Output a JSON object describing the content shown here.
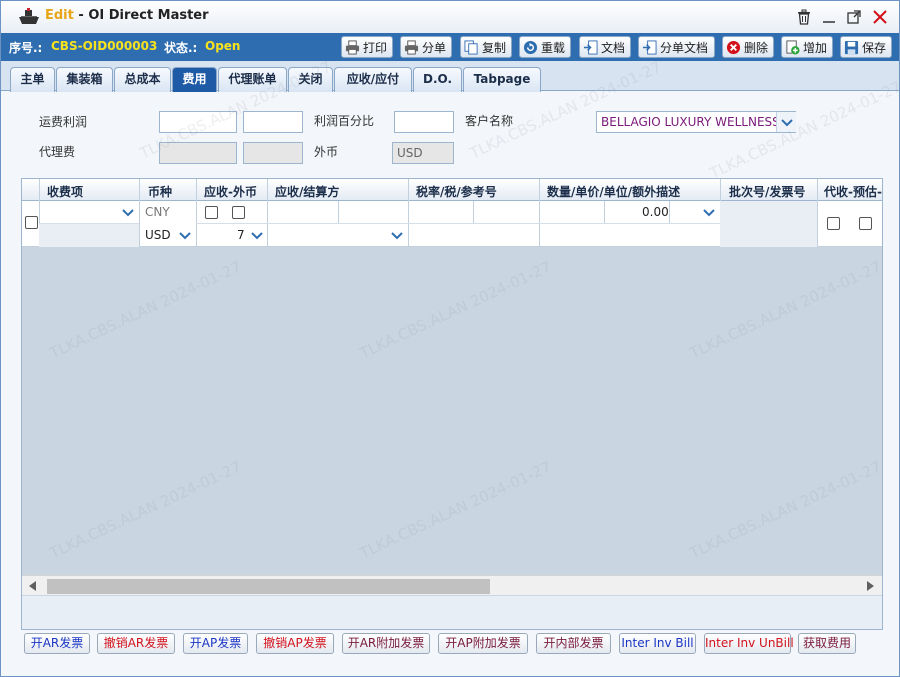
{
  "window": {
    "title_prefix": "Edit",
    "title_sep": " - ",
    "title": "OI Direct Master"
  },
  "info": {
    "serial_label": "序号.:",
    "serial_value": "CBS-OID000003",
    "status_label": "状态.:",
    "status_value": "Open"
  },
  "toolbar": {
    "print": "打印",
    "split": "分单",
    "copy": "复制",
    "reload": "重载",
    "docs": "文档",
    "split_docs": "分单文档",
    "delete": "删除",
    "add": "增加",
    "save": "保存"
  },
  "tabs": [
    {
      "label": "主单"
    },
    {
      "label": "集装箱"
    },
    {
      "label": "总成本"
    },
    {
      "label": "费用"
    },
    {
      "label": "代理账单"
    },
    {
      "label": "关闭"
    },
    {
      "label": "应收/应付"
    },
    {
      "label": "D.O."
    },
    {
      "label": "Tabpage"
    }
  ],
  "form": {
    "freight_profit_label": "运费利润",
    "agency_fee_label": "代理费",
    "profit_pct_label": "利润百分比",
    "foreign_currency_label": "外币",
    "foreign_currency_value": "USD",
    "customer_label": "客户名称",
    "customer_value": "BELLAGIO LUXURY WELLNESS"
  },
  "grid": {
    "headers": {
      "charge_item": "收费项",
      "currency": "币种",
      "ar_foreign": "应收-外币",
      "ar_settlement": "应收/结算方",
      "tax": "税率/税/参考号",
      "qty": "数量/单价/单位/额外描述",
      "batch": "批次号/发票号",
      "collect": "代收-预估-"
    },
    "row": {
      "currency1": "CNY",
      "currency2": "USD",
      "rate": "7",
      "amount": "0.00"
    }
  },
  "bottom_buttons": {
    "open_ar": "开AR发票",
    "cancel_ar": "撤销AR发票",
    "open_ap": "开AP发票",
    "cancel_ap": "撤销AP发票",
    "open_ar_add": "开AR附加发票",
    "open_ap_add": "开AP附加发票",
    "open_internal": "开内部发票",
    "inter_inv_bill": "Inter Inv Bill",
    "inter_inv_unbill": "Inter Inv UnBill",
    "get_fees": "获取费用"
  },
  "watermark": "TLKA.CBS.ALAN 2024-01-27",
  "icons": {
    "app": "ship-icon",
    "trash": "trash-icon",
    "minimize": "minimize-icon",
    "maximize": "maximize-icon",
    "close": "close-icon"
  },
  "colors": {
    "infobar": "#2f6db1",
    "highlight": "#f8e21d",
    "active_tab": "#1f5aa6",
    "close": "#d2111b"
  }
}
